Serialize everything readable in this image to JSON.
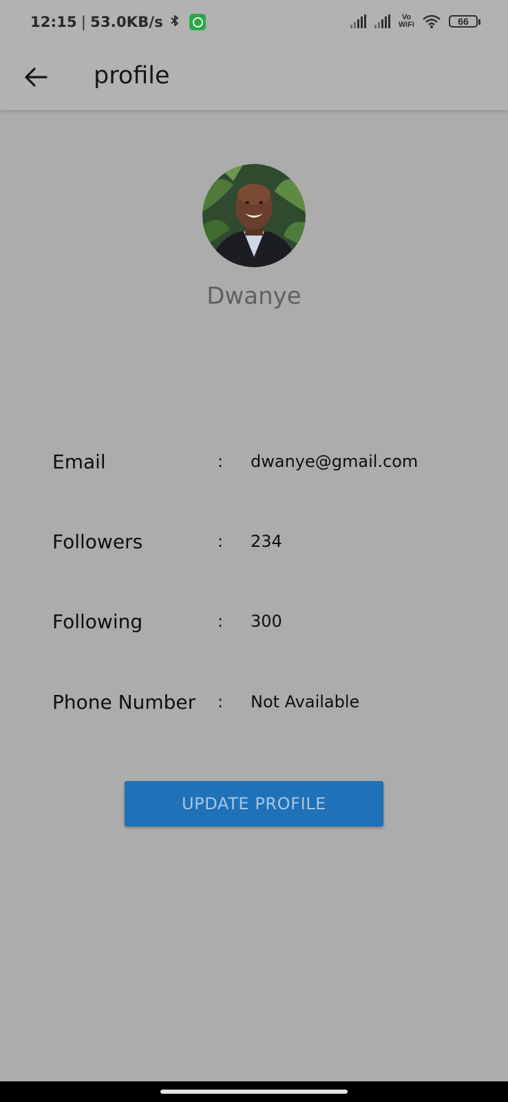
{
  "status_bar": {
    "time": "12:15",
    "separator": "|",
    "net_speed": "53.0KB/s",
    "bluetooth_icon": "bluetooth-icon",
    "notification_icon": "whatsapp-icon",
    "vowifi_top": "Vo",
    "vowifi_bottom": "WiFi",
    "battery_level": "66"
  },
  "app_bar": {
    "back_icon": "arrow-back-icon",
    "title": "profile"
  },
  "profile": {
    "name": "Dwanye"
  },
  "details": [
    {
      "label": "Email",
      "separator": ":",
      "value": "dwanye@gmail.com"
    },
    {
      "label": "Followers",
      "separator": ":",
      "value": "234"
    },
    {
      "label": "Following",
      "separator": ":",
      "value": "300"
    },
    {
      "label": "Phone Number",
      "separator": ":",
      "value": "Not Available"
    }
  ],
  "actions": {
    "update_label": "UPDATE PROFILE"
  },
  "colors": {
    "background": "#acacac",
    "app_bar": "#b2b2b2",
    "primary_button": "#1f71b8",
    "button_text": "#a9c5e2",
    "name_text": "#606060"
  }
}
